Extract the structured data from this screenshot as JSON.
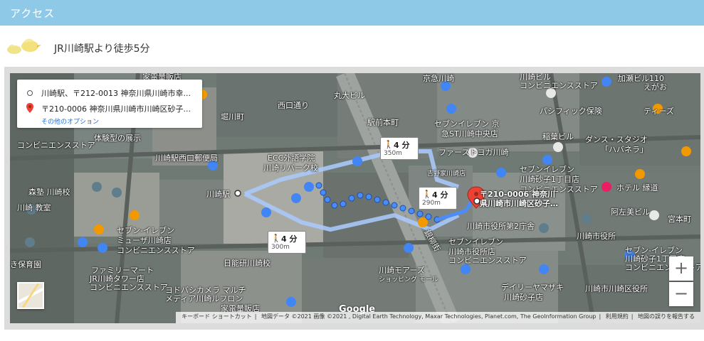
{
  "section": {
    "title": "アクセス"
  },
  "access": {
    "text": "JR川崎駅より徒歩5分"
  },
  "directions": {
    "origin": "川崎駅、〒212-0013 神奈川県川崎市幸...",
    "destination": "〒210-0006 神奈川県川崎市川崎区砂子...",
    "more_options": "その他のオプション"
  },
  "walk_routes": [
    {
      "time": "4 分",
      "distance": "350m"
    },
    {
      "time": "4 分",
      "distance": "290m"
    },
    {
      "time": "4 分",
      "distance": "300m"
    }
  ],
  "destination_label": {
    "line1": "〒210-0006 神奈川",
    "line2": "県川崎市川崎区砂子…"
  },
  "station_label": "川崎駅",
  "map_labels": [
    "家電量販店",
    "京急川崎",
    "川崎ビル",
    "コンビニエンスストア",
    "加瀬ビル110",
    "えがお",
    "丸大ビル",
    "堀川町",
    "西口通り",
    "駅前本町",
    "パシフィック保険",
    "ティーズ",
    "セブンイレブン 京",
    "急ST川崎中央店",
    "稲葉ビル",
    "ダンス・スタジオ",
    "「ハバネラ」",
    "ファーストヨガ川崎",
    "体験型の展示",
    "コンビニエンスストア",
    "川崎駅西口郵便局",
    "ECC外語学院",
    "川崎リバーク校",
    "吉野家川崎店",
    "セブンイレブン",
    "川崎砂子1丁目店",
    "コンビニエンスストア",
    "ホテル 縁道",
    "森塾 川崎校",
    "川崎 教室",
    "阿左美ビル",
    "宮本町",
    "セブン-イレブン",
    "ミューザ川崎店",
    "コンビニエンスストア",
    "川崎市役所第2庁舎",
    "川崎市役所",
    "セブン-イレブン",
    "川崎砂子1丁目店",
    "コンビニエンスストア",
    "セブンイレブン",
    "川崎市役所店",
    "コンビニエンスストア",
    "き保育園",
    "ファミリーマート",
    "JR川崎タワー店",
    "コンビニエンスストア",
    "日能研川崎校",
    "川崎モアーズ",
    "ショッピング モール",
    "ヨドバシカメラ マルチ",
    "メディア川崎ルフロン",
    "家電量販店",
    "デイリーヤマザキ",
    "川崎市川崎区役所",
    "川崎砂子店",
    "銀柳街"
  ],
  "attribution": {
    "shortcuts": "キーボード ショートカット",
    "mapdata": "地図データ ©2021 画像 ©2021 , Digital Earth Technology, Maxar Technologies, Planet.com, The GeoInformation Group",
    "terms": "利用規約",
    "report": "地図の誤りを報告する"
  },
  "google_logo": "Google",
  "zoom": {
    "in": "+",
    "out": "−"
  },
  "colors": {
    "header": "#8ecae8",
    "route": "#4b8df8",
    "route_alt": "#a8c8f8",
    "pin": "#ea4335"
  }
}
